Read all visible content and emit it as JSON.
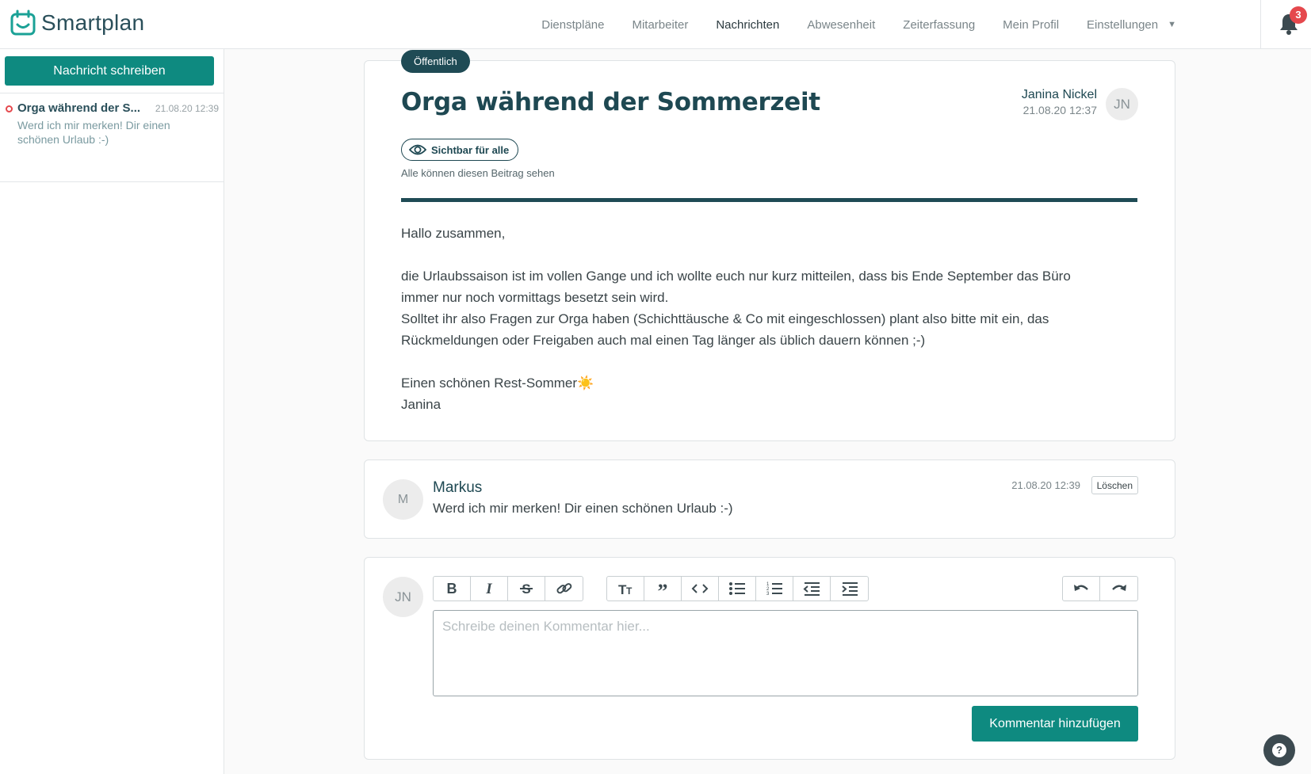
{
  "brand": {
    "name": "Smartplan",
    "accent": "#0e8a80",
    "dark": "#1f4b55"
  },
  "nav": {
    "items": [
      {
        "label": "Dienstpläne"
      },
      {
        "label": "Mitarbeiter"
      },
      {
        "label": "Nachrichten",
        "active": true
      },
      {
        "label": "Abwesenheit"
      },
      {
        "label": "Zeiterfassung"
      },
      {
        "label": "Mein Profil"
      }
    ],
    "settings_label": "Einstellungen",
    "notifications_count": "3"
  },
  "sidebar": {
    "compose_label": "Nachricht schreiben",
    "messages": [
      {
        "title": "Orga während der S...",
        "time": "21.08.20 12:39",
        "preview": "Werd ich mir merken! Dir einen schönen Urlaub :-)",
        "unread": true
      }
    ]
  },
  "post": {
    "visibility_pill": "Öffentlich",
    "title": "Orga während der Sommerzeit",
    "author_name": "Janina Nickel",
    "author_time": "21.08.20 12:37",
    "author_initials": "JN",
    "visibility_label": "Sichtbar für alle",
    "visibility_note": "Alle können diesen Beitrag sehen",
    "body": {
      "greeting": "Hallo zusammen,",
      "line1": "die Urlaubssaison ist im vollen Gange und ich wollte euch nur kurz mitteilen, dass bis Ende September das Büro",
      "line2": "immer nur noch vormittags besetzt sein wird.",
      "line3": "Solltet ihr also Fragen zur Orga haben (Schichttäusche & Co mit eingeschlossen)  plant also bitte mit ein, das",
      "line4": "Rückmeldungen oder Freigaben auch mal einen Tag länger als üblich dauern können ;-)",
      "closing": "Einen schönen Rest-Sommer☀️",
      "signature": "Janina"
    }
  },
  "comment": {
    "author_initials": "M",
    "author": "Markus",
    "text": "Werd ich mir merken! Dir einen schönen Urlaub :-)",
    "time": "21.08.20 12:39",
    "delete_label": "Löschen"
  },
  "editor": {
    "user_initials": "JN",
    "placeholder": "Schreibe deinen Kommentar hier...",
    "submit_label": "Kommentar hinzufügen",
    "toolbar": [
      "bold-icon",
      "italic-icon",
      "strikethrough-icon",
      "link-icon",
      "heading-icon",
      "quote-icon",
      "code-icon",
      "bullet-list-icon",
      "numbered-list-icon",
      "outdent-icon",
      "indent-icon",
      "undo-icon",
      "redo-icon"
    ]
  },
  "help_label": "?"
}
